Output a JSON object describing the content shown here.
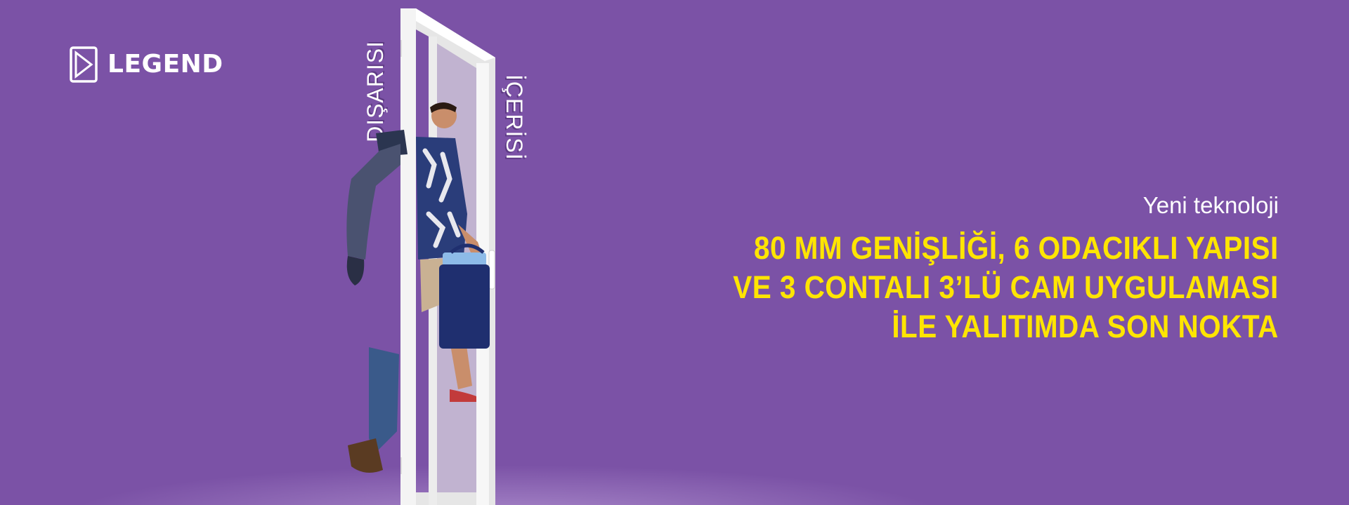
{
  "brand": {
    "name": "LEGEND",
    "icon": "logo-window-icon"
  },
  "door_labels": {
    "outside": "DIŞARISI",
    "inside": "İÇERİSİ"
  },
  "copy": {
    "subtitle": "Yeni teknoloji",
    "headline": [
      "80 MM GENİŞLİĞİ, 6 ODACIKLI YAPISI",
      "VE 3 CONTALI 3’LÜ CAM UYGULAMASI",
      "İLE YALITIMDA SON NOKTA"
    ]
  },
  "colors": {
    "background": "#7b52a6",
    "headline": "#ffe500",
    "text": "#ffffff",
    "door_frame": "#f2f2f2"
  }
}
